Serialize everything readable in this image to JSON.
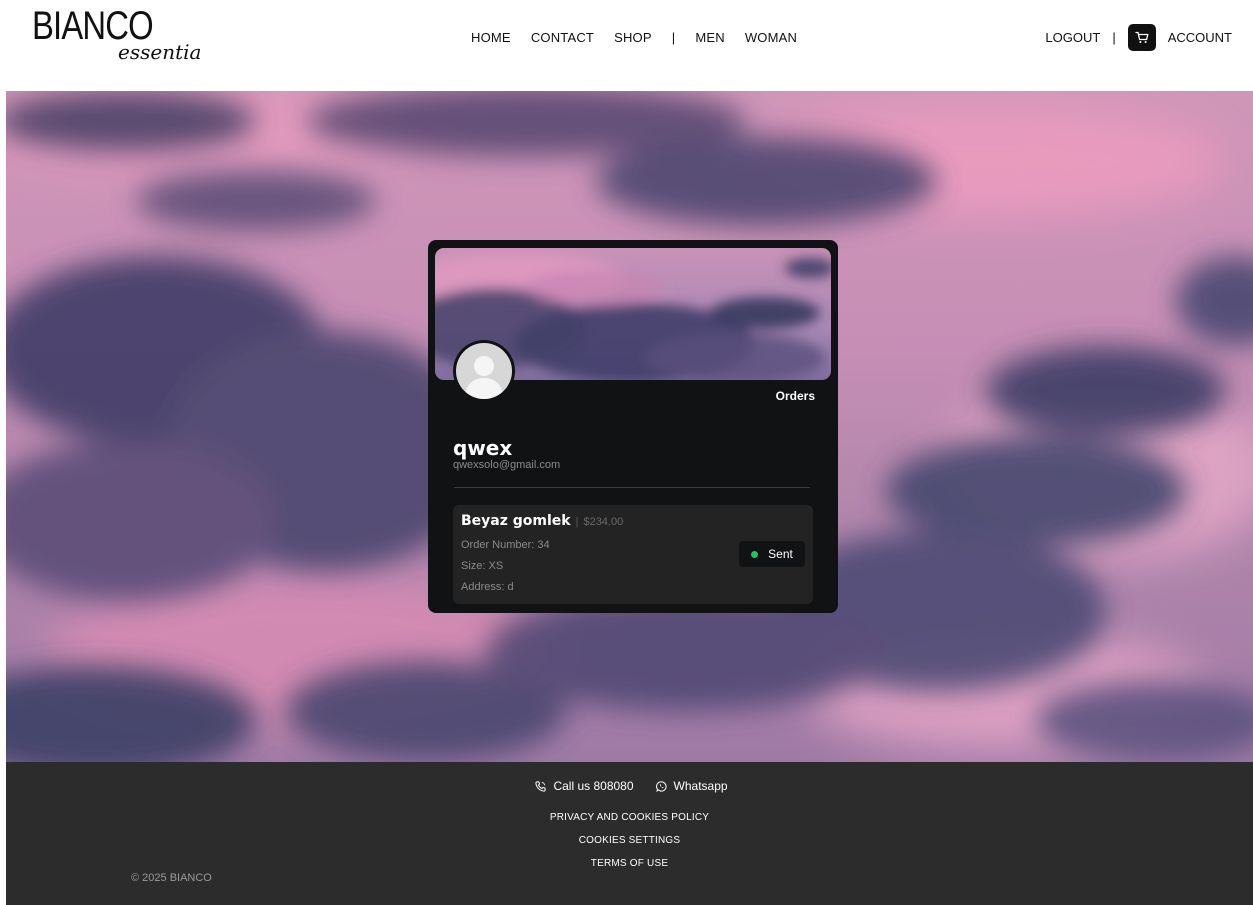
{
  "brand": {
    "main": "BIANCO",
    "sub": "essentia"
  },
  "nav": {
    "items": [
      "HOME",
      "CONTACT",
      "SHOP",
      "MEN",
      "WOMAN"
    ],
    "separator": "|"
  },
  "account_nav": {
    "logout_label": "LOGOUT",
    "separator": "|",
    "cart_icon": "cart-icon",
    "account_label": "ACCOUNT"
  },
  "profile": {
    "orders_label": "Orders",
    "name": "qwex",
    "email": "qwexsolo@gmail.com",
    "avatar_icon": "user-silhouette-icon"
  },
  "orders": [
    {
      "product": "Beyaz gomlek",
      "separator": "|",
      "price": "$234.00",
      "order_number": "Order Number: 34",
      "size": "Size: XS",
      "address": "Address: d",
      "status": "Sent",
      "status_color": "#22c55e"
    }
  ],
  "footer": {
    "call_label": "Call us 808080",
    "call_icon": "phone-icon",
    "whatsapp_label": "Whatsapp",
    "whatsapp_icon": "whatsapp-icon",
    "links": [
      "PRIVACY AND COOKIES POLICY",
      "COOKIES SETTINGS",
      "TERMS OF USE"
    ],
    "copyright": "© 2025 BIANCO"
  },
  "colors": {
    "card_bg": "#111213",
    "order_bg": "#232324",
    "footer_bg": "#2c2c2c",
    "status_dot": "#22c55e"
  }
}
